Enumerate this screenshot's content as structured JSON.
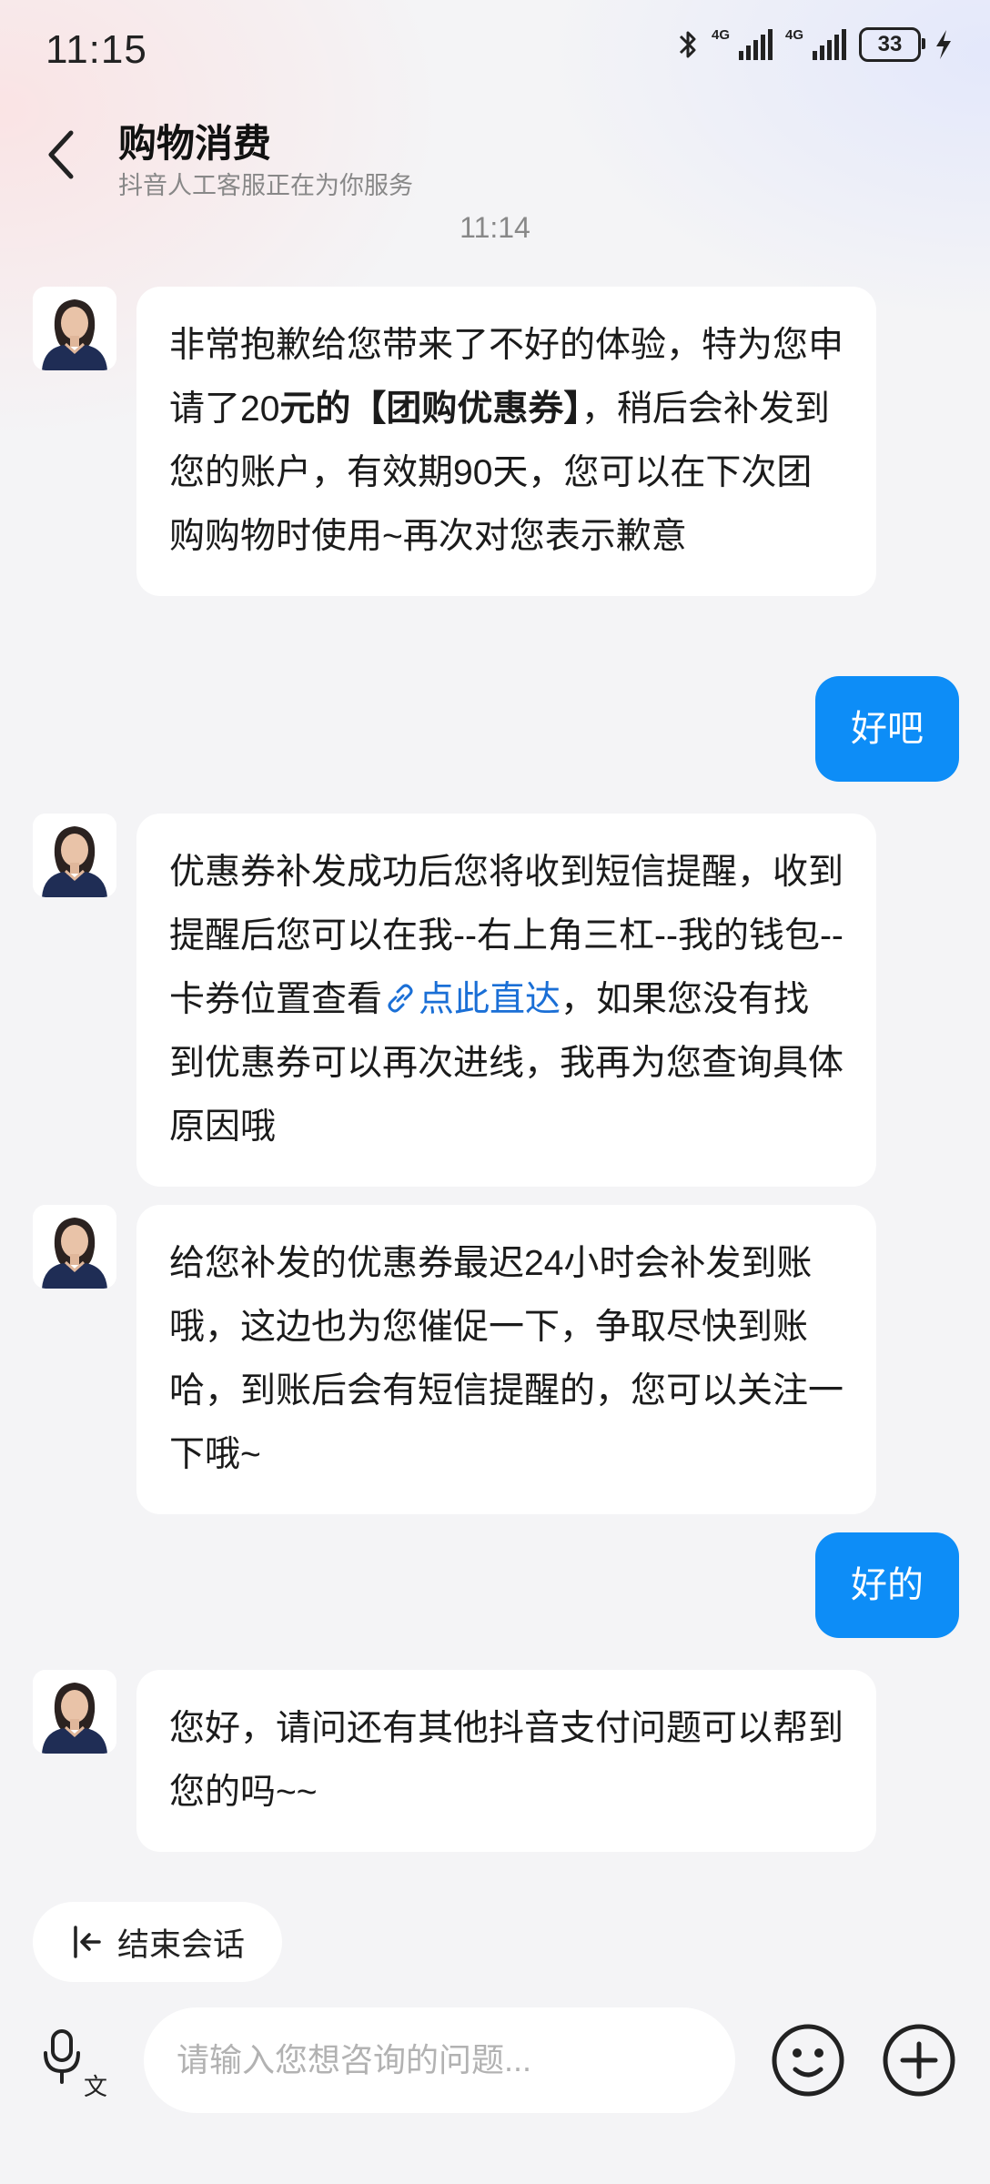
{
  "status_bar": {
    "time": "11:15",
    "battery": "33",
    "network_left": "4G",
    "network_right": "4G"
  },
  "header": {
    "title": "购物消费",
    "subtitle": "抖音人工客服正在为你服务"
  },
  "timestamp": "11:14",
  "messages": [
    {
      "from": "agent",
      "parts": [
        {
          "text": "非常抱歉给您带来了不好的体验，特为您申请了20"
        },
        {
          "text": "元的【团购优惠券】",
          "bold": true
        },
        {
          "text": "，稍后会补发到您的账户，有效期90天，您可以在下次团购购物时使用~再次对您表示歉意"
        }
      ]
    },
    {
      "from": "user",
      "text": "好吧"
    },
    {
      "from": "agent",
      "parts": [
        {
          "text": "优惠券补发成功后您将收到短信提醒，收到提醒后您可以在我--右上角三杠--我的钱包--卡券位置查看"
        },
        {
          "text": "点此直达",
          "link": true
        },
        {
          "text": "，如果您没有找到优惠券可以再次进线，我再为您查询具体原因哦"
        }
      ]
    },
    {
      "from": "agent",
      "parts": [
        {
          "text": "给您补发的优惠券最迟24小时会补发到账哦，这边也为您催促一下，争取尽快到账哈，到账后会有短信提醒的，您可以关注一下哦~"
        }
      ]
    },
    {
      "from": "user",
      "text": "好的"
    },
    {
      "from": "agent",
      "parts": [
        {
          "text": "您好，请问还有其他抖音支付问题可以帮到您的吗~~"
        }
      ]
    }
  ],
  "end_session": {
    "label": "结束会话",
    "icon": "exit-icon"
  },
  "input": {
    "placeholder": "请输入您想咨询的问题..."
  },
  "colors": {
    "accent": "#0d8df7",
    "link": "#1a6fd6",
    "bubble": "#ffffff",
    "background": "#f4f4f6"
  }
}
